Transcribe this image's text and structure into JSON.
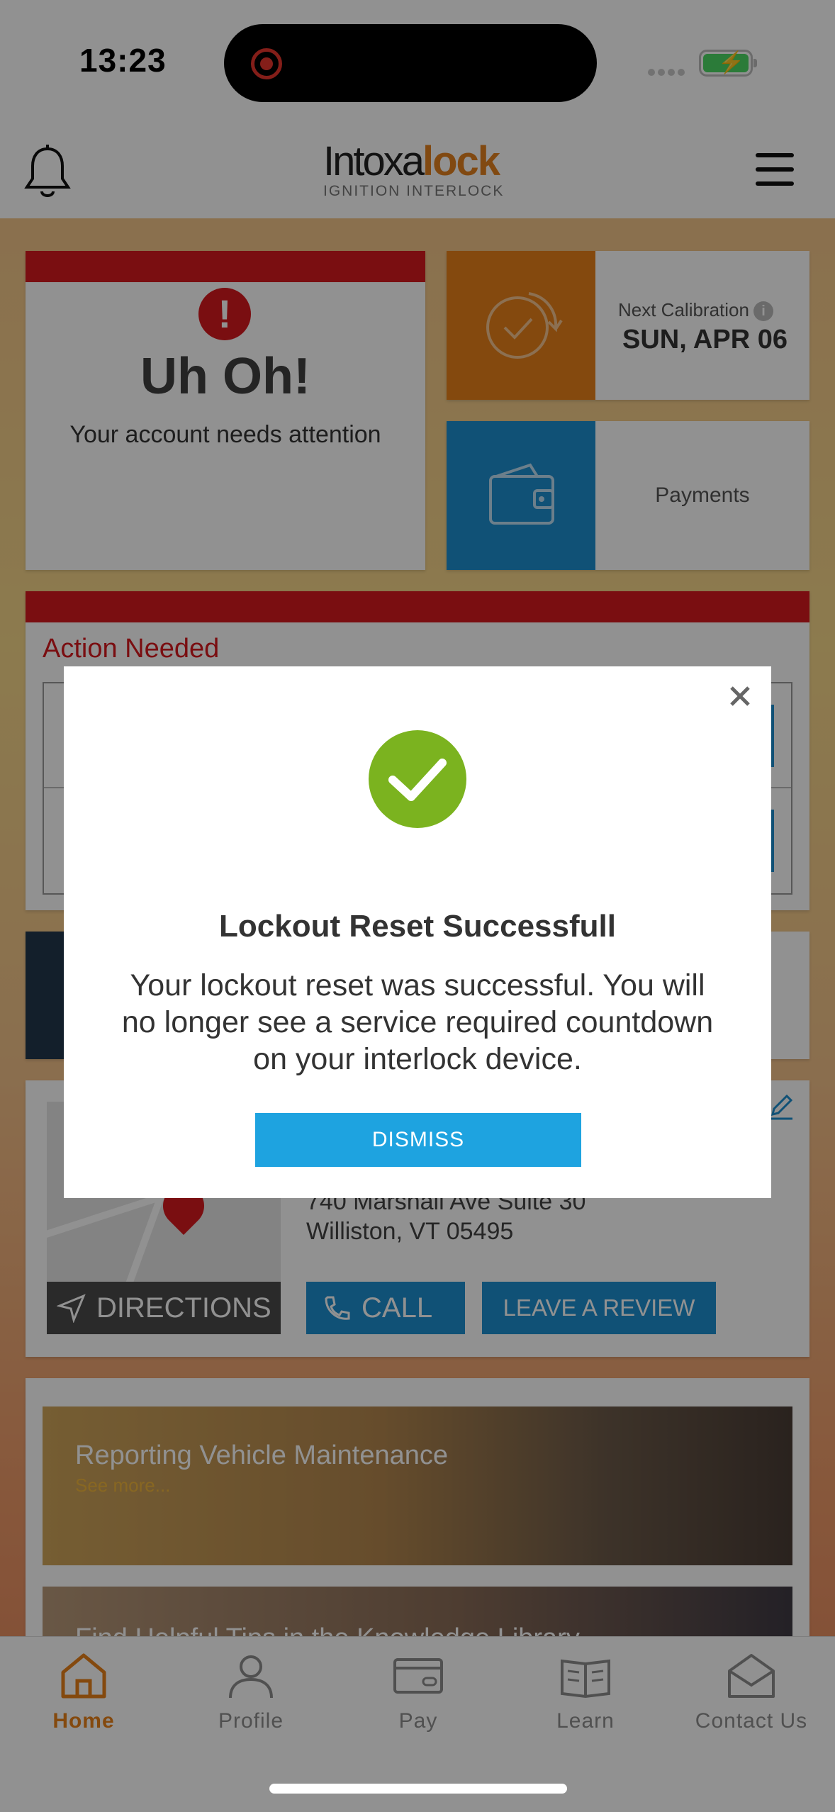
{
  "status_bar": {
    "time": "13:23"
  },
  "header": {
    "logo_text_main": "Intoxa",
    "logo_text_accent": "lock",
    "logo_tagline": "IGNITION INTERLOCK"
  },
  "alert_card": {
    "heading": "Uh Oh!",
    "message": "Your account needs attention"
  },
  "calibration_tile": {
    "label": "Next Calibration",
    "date": "SUN, APR 06"
  },
  "payments_tile": {
    "label": "Payments"
  },
  "action_card": {
    "title": "Action Needed"
  },
  "location_card": {
    "address_line1": "740 Marshall Ave Suite 30",
    "address_line2": "Williston, VT 05495",
    "directions_label": "DIRECTIONS",
    "call_label": "CALL",
    "review_label": "LEAVE A REVIEW"
  },
  "news_card": {
    "item1_title": "Reporting Vehicle Maintenance",
    "item1_link": "See more...",
    "item2_title": "Find Helpful Tips in the Knowledge Library"
  },
  "tabs": [
    {
      "label": "Home",
      "icon": "home-icon"
    },
    {
      "label": "Profile",
      "icon": "profile-icon"
    },
    {
      "label": "Pay",
      "icon": "card-icon"
    },
    {
      "label": "Learn",
      "icon": "book-icon"
    },
    {
      "label": "Contact Us",
      "icon": "envelope-icon"
    }
  ],
  "modal": {
    "title": "Lockout Reset Successfull",
    "body": "Your lockout reset was successful. You will no longer see a service required countdown on your interlock device.",
    "button_label": "DISMISS"
  },
  "colors": {
    "brand_orange": "#e8811a",
    "alert_red": "#d7191e",
    "action_blue": "#1d8fd0",
    "success_green": "#7bb31f"
  }
}
